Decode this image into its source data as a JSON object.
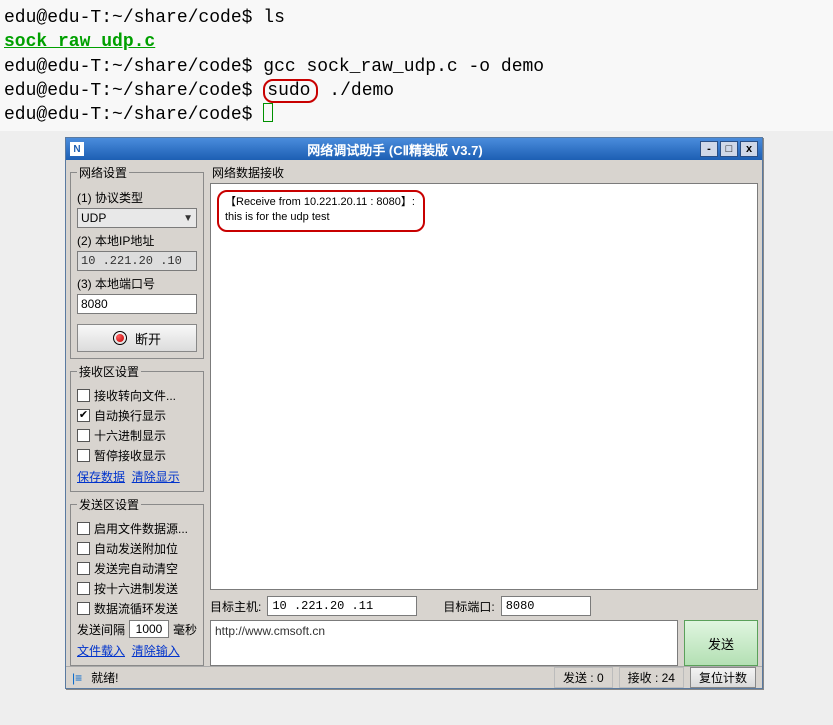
{
  "terminal": {
    "prompt": "edu@edu-T:~/share/code$",
    "cmd_ls": "ls",
    "file": "sock_raw_udp.c",
    "cmd_gcc": "gcc sock_raw_udp.c -o demo",
    "sudo": "sudo",
    "cmd_run": " ./demo"
  },
  "app": {
    "title": "网络调试助手 (CⅡ精装版 V3.7)",
    "min": "-",
    "max": "□",
    "close": "x"
  },
  "net_settings": {
    "legend": "网络设置",
    "proto_label": "(1) 协议类型",
    "proto_value": "UDP",
    "ip_label": "(2) 本地IP地址",
    "ip_value": "10 .221.20 .10",
    "port_label": "(3) 本地端口号",
    "port_value": "8080",
    "disconnect": "断开"
  },
  "recv_settings": {
    "legend": "接收区设置",
    "opt_to_file": "接收转向文件...",
    "opt_auto_wrap": "自动换行显示",
    "opt_hex": "十六进制显示",
    "opt_pause": "暂停接收显示",
    "link_save": "保存数据",
    "link_clear": "清除显示"
  },
  "send_settings": {
    "legend": "发送区设置",
    "opt_file_src": "启用文件数据源...",
    "opt_auto_suffix": "自动发送附加位",
    "opt_auto_clear": "发送完自动清空",
    "opt_hex_send": "按十六进制发送",
    "opt_loop": "数据流循环发送",
    "interval_label": "发送间隔",
    "interval_value": "1000",
    "interval_unit": "毫秒",
    "link_load": "文件载入",
    "link_clear": "清除输入"
  },
  "recv_area": {
    "legend": "网络数据接收",
    "line1": "【Receive from 10.221.20.11 : 8080】:",
    "line2": "this is for the udp test"
  },
  "target": {
    "host_label": "目标主机:",
    "host_value": "10 .221.20 .11",
    "port_label": "目标端口:",
    "port_value": "8080"
  },
  "send": {
    "text": "http://www.cmsoft.cn",
    "btn": "发送"
  },
  "status": {
    "ready": "就绪!",
    "sent": "发送 : 0",
    "recv": "接收 : 24",
    "reset": "复位计数"
  }
}
